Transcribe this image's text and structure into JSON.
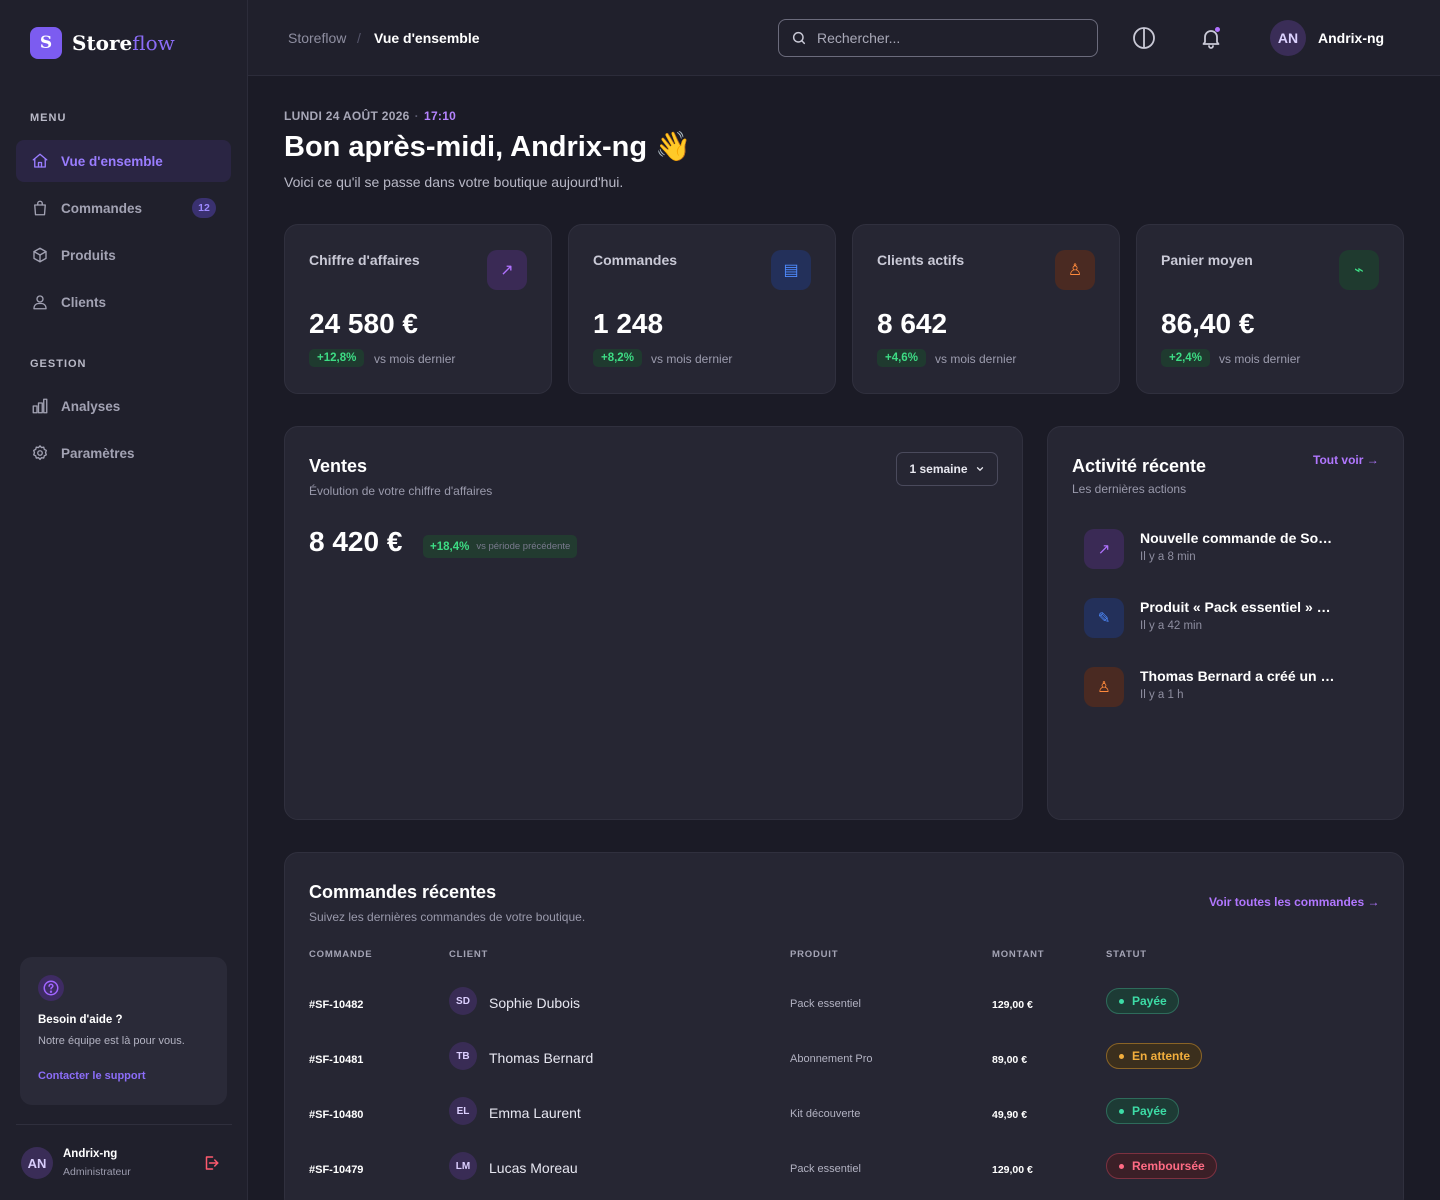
{
  "app": {
    "logo_letter": "S",
    "name_part1": "Store",
    "name_part2": "flow",
    "accent_color": "#8b6cf6"
  },
  "sidebar": {
    "section_menu": "MENU",
    "section_gestion": "GESTION",
    "menu_items": [
      {
        "label": "Vue d'ensemble",
        "icon": "home-icon",
        "active": true
      },
      {
        "label": "Commandes",
        "icon": "shopping-bag-icon",
        "badge": "12"
      },
      {
        "label": "Produits",
        "icon": "box-icon"
      },
      {
        "label": "Clients",
        "icon": "users-icon"
      }
    ],
    "gestion_items": [
      {
        "label": "Analyses",
        "icon": "bar-chart-icon"
      },
      {
        "label": "Paramètres",
        "icon": "gear-icon"
      }
    ],
    "help": {
      "title": "Besoin d'aide ?",
      "text": "Notre équipe est là pour vous.",
      "link": "Contacter le support"
    },
    "user": {
      "initials": "AN",
      "name": "Andrix-ng",
      "role": "Administrateur"
    }
  },
  "header": {
    "breadcrumb": [
      "Storeflow",
      "Vue d'ensemble"
    ],
    "breadcrumb_sep": "/",
    "search_placeholder": "Rechercher...",
    "user_initials": "AN",
    "user_name": "Andrix-ng"
  },
  "greeting": {
    "date": "LUNDI 24 AOÛT 2026",
    "sep": "·",
    "time": "17:10",
    "title": "Bon après-midi, Andrix-ng 👋",
    "subtitle": "Voici ce qu'il se passe dans votre boutique aujourd'hui."
  },
  "kpis": [
    {
      "label": "Chiffre d'affaires",
      "value": "24 580 €",
      "delta": "+12,8%",
      "vs": "vs mois dernier",
      "icon": "arrow-up-right-icon",
      "icon_glyph": "↗",
      "color": "#b072ff",
      "bg": "#3a2a55"
    },
    {
      "label": "Commandes",
      "value": "1 248",
      "delta": "+8,2%",
      "vs": "vs mois dernier",
      "icon": "list-icon",
      "icon_glyph": "▤",
      "color": "#4f8bff",
      "bg": "#23305a"
    },
    {
      "label": "Clients actifs",
      "value": "8 642",
      "delta": "+4,6%",
      "vs": "vs mois dernier",
      "icon": "user-icon",
      "icon_glyph": "♙",
      "color": "#ff8a3c",
      "bg": "#4a2a22"
    },
    {
      "label": "Panier moyen",
      "value": "86,40 €",
      "delta": "+2,4%",
      "vs": "vs mois dernier",
      "icon": "trend-icon",
      "icon_glyph": "⌁",
      "color": "#3ddc84",
      "bg": "#1f3a2f"
    }
  ],
  "sales": {
    "title": "Ventes",
    "subtitle": "Évolution de votre chiffre d'affaires",
    "period": "1 semaine",
    "value": "8 420 €",
    "delta": "+18,4%",
    "delta_text": "vs période précédente"
  },
  "activity": {
    "title": "Activité récente",
    "subtitle": "Les dernières actions",
    "see_all": "Tout voir →",
    "items": [
      {
        "title": "Nouvelle commande de So…",
        "time": "Il y a 8 min",
        "icon": "arrow-up-right-icon",
        "glyph": "↗",
        "color": "#b072ff",
        "bg": "#3a2a55"
      },
      {
        "title": "Produit « Pack essentiel » …",
        "time": "Il y a 42 min",
        "icon": "pencil-icon",
        "glyph": "✎",
        "color": "#4f8bff",
        "bg": "#23305a"
      },
      {
        "title": "Thomas Bernard a créé un …",
        "time": "Il y a 1 h",
        "icon": "user-icon",
        "glyph": "♙",
        "color": "#ff8a3c",
        "bg": "#4a2a22"
      }
    ]
  },
  "orders": {
    "title": "Commandes récentes",
    "subtitle": "Suivez les dernières commandes de votre boutique.",
    "see_all": "Voir toutes les commandes →",
    "columns": [
      "COMMANDE",
      "CLIENT",
      "PRODUIT",
      "MONTANT",
      "STATUT"
    ],
    "rows": [
      {
        "id": "#SF-10482",
        "initials": "SD",
        "client": "Sophie Dubois",
        "product": "Pack essentiel",
        "amount": "129,00 €",
        "status": "Payée",
        "status_kind": "paid"
      },
      {
        "id": "#SF-10481",
        "initials": "TB",
        "client": "Thomas Bernard",
        "product": "Abonnement Pro",
        "amount": "89,00 €",
        "status": "En attente",
        "status_kind": "wait"
      },
      {
        "id": "#SF-10480",
        "initials": "EL",
        "client": "Emma Laurent",
        "product": "Kit découverte",
        "amount": "49,90 €",
        "status": "Payée",
        "status_kind": "paid"
      },
      {
        "id": "#SF-10479",
        "initials": "LM",
        "client": "Lucas Moreau",
        "product": "Pack essentiel",
        "amount": "129,00 €",
        "status": "Remboursée",
        "status_kind": "ref"
      }
    ]
  }
}
